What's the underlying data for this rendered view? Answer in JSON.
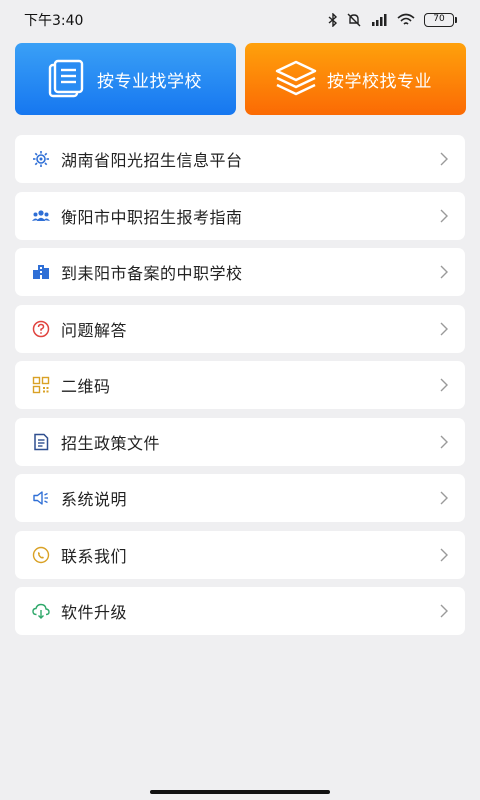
{
  "status_bar": {
    "time": "下午3:40",
    "battery": "70",
    "icons": [
      "bluetooth-icon",
      "mute-icon",
      "signal-icon",
      "wifi-icon",
      "battery-icon"
    ]
  },
  "top_cards": [
    {
      "label": "按专业找学校",
      "icon": "document-list-icon",
      "color": "#1f82f2"
    },
    {
      "label": "按学校找专业",
      "icon": "layers-icon",
      "color": "#fc7a06"
    }
  ],
  "menu": [
    {
      "label": "湖南省阳光招生信息平台",
      "icon": "sun-gear-icon",
      "color": "#2f6fd6"
    },
    {
      "label": "衡阳市中职招生报考指南",
      "icon": "people-icon",
      "color": "#2f6fd6"
    },
    {
      "label": "到耒阳市备案的中职学校",
      "icon": "school-building-icon",
      "color": "#2f6fd6"
    },
    {
      "label": "问题解答",
      "icon": "question-icon",
      "color": "#e0443f"
    },
    {
      "label": "二维码",
      "icon": "qr-code-icon",
      "color": "#d9a125"
    },
    {
      "label": "招生政策文件",
      "icon": "policy-document-icon",
      "color": "#2f4f8f"
    },
    {
      "label": "系统说明",
      "icon": "speaker-icon",
      "color": "#2f6fd6"
    },
    {
      "label": "联系我们",
      "icon": "phone-icon",
      "color": "#d9a125"
    },
    {
      "label": "软件升级",
      "icon": "cloud-download-icon",
      "color": "#2fa86a"
    }
  ]
}
